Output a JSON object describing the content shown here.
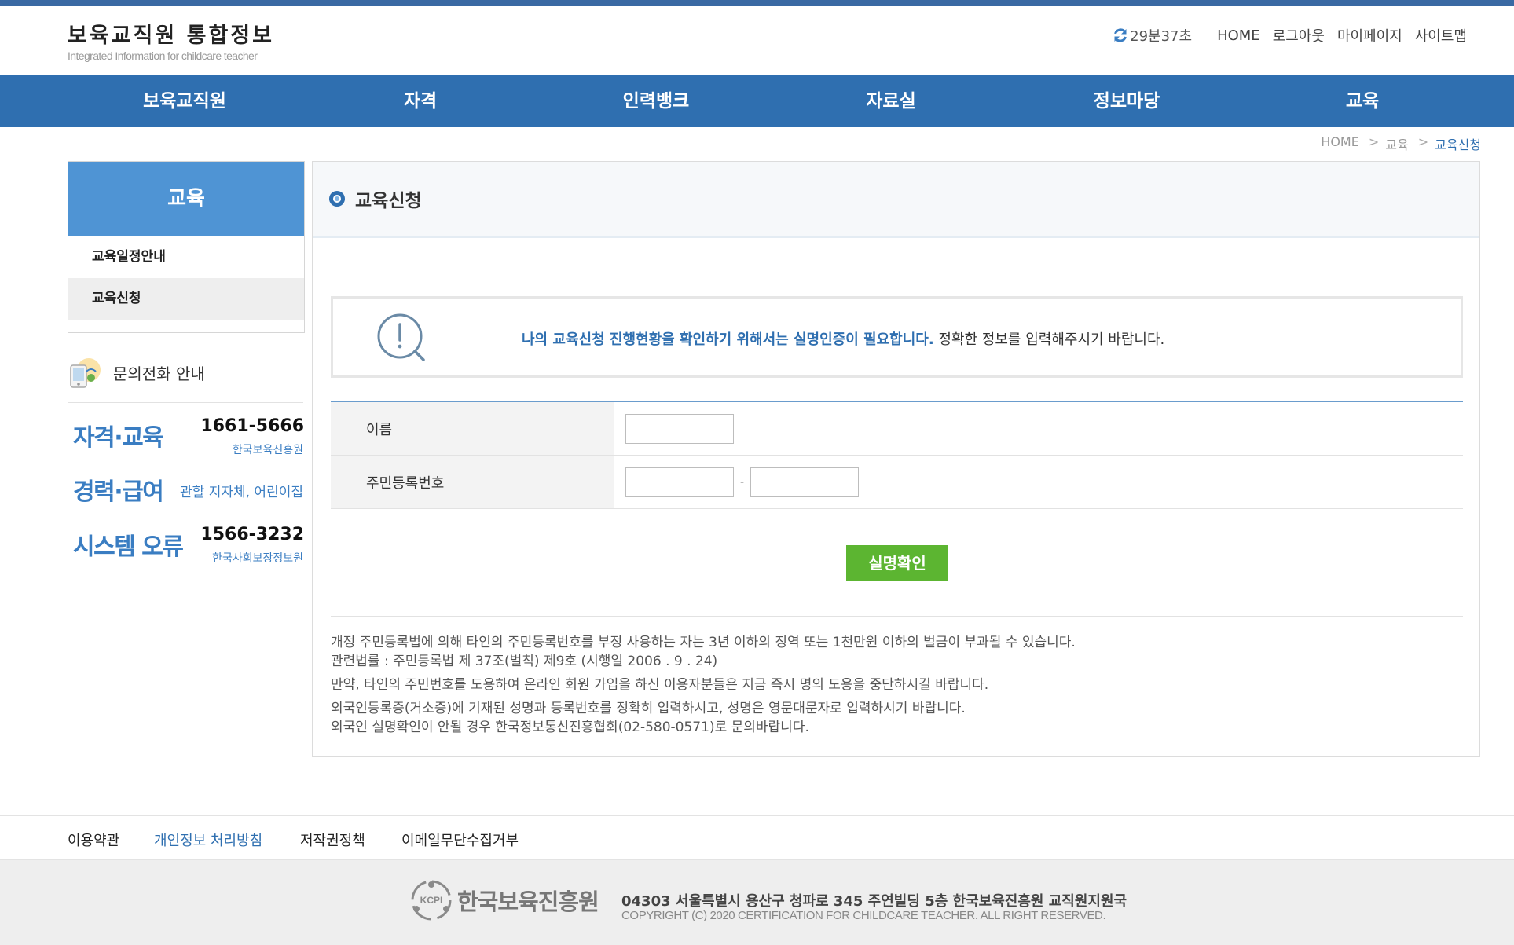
{
  "header": {
    "logo_title": "보육교직원 통합정보",
    "logo_subtitle": "Integrated Information for childcare teacher",
    "session_timer": "29분37초",
    "links": [
      "HOME",
      "로그아웃",
      "마이페이지",
      "사이트맵"
    ]
  },
  "gnb": [
    "보육교직원",
    "자격",
    "인력뱅크",
    "자료실",
    "정보마당",
    "교육"
  ],
  "breadcrumb": {
    "home": "HOME",
    "level1": "교육",
    "current": "교육신청",
    "separator": ">"
  },
  "sidebar": {
    "title": "교육",
    "items": [
      {
        "label": "교육일정안내",
        "active": false
      },
      {
        "label": "교육신청",
        "active": true
      }
    ],
    "contact_heading": "문의전화 안내",
    "contacts": [
      {
        "category": "자격·교육",
        "number": "1661-5666",
        "org": "한국보육진흥원"
      },
      {
        "category": "경력·급여",
        "org": "관할 지자체, 어린이집"
      },
      {
        "category": "시스템 오류",
        "number": "1566-3232",
        "org": "한국사회보장정보원"
      }
    ]
  },
  "main": {
    "title": "교육신청",
    "notice_highlight": "나의 교육신청 진행현황을 확인하기 위해서는 실명인증이 필요합니다.",
    "notice_rest": " 정확한 정보를 입력해주시기 바랍니다.",
    "form": {
      "name_label": "이름",
      "name_value": "",
      "rrn_label": "주민등록번호",
      "rrn_front": "",
      "rrn_back": "",
      "rrn_separator": "-"
    },
    "confirm_button": "실명확인",
    "legal": [
      "개정 주민등록법에 의해 타인의 주민등록번호를 부정 사용하는 자는 3년 이하의 징역 또는 1천만원 이하의 벌금이 부과될 수 있습니다.",
      "관련법률 : 주민등록법 제 37조(벌칙) 제9호 (시행일 2006 . 9 . 24)",
      "만약, 타인의 주민번호를 도용하여 온라인 회원 가입을 하신 이용자분들은 지금 즉시 명의 도용을 중단하시길 바랍니다.",
      "외국인등록증(거소증)에 기재된 성명과 등록번호를 정확히 입력하시고, 성명은 영문대문자로 입력하시기 바랍니다.",
      "외국인 실명확인이 안될 경우 한국정보통신진흥협회(02-580-0571)로 문의바랍니다."
    ]
  },
  "footer": {
    "links": [
      "이용약관",
      "개인정보 처리방침",
      "저작권정책",
      "이메일무단수집거부"
    ],
    "logo_text": "한국보육진흥원",
    "logo_mark": "KCPI",
    "address": "04303 서울특별시 용산구 청파로 345 주연빌딩 5층 한국보육진흥원 교직원지원국",
    "copyright": "COPYRIGHT (C) 2020 CERTIFICATION FOR CHILDCARE TEACHER. ALL RIGHT RESERVED."
  },
  "colors": {
    "brand_blue": "#2f6fb0",
    "sidebar_title_blue": "#4f94d4",
    "confirm_green": "#5cb531"
  }
}
